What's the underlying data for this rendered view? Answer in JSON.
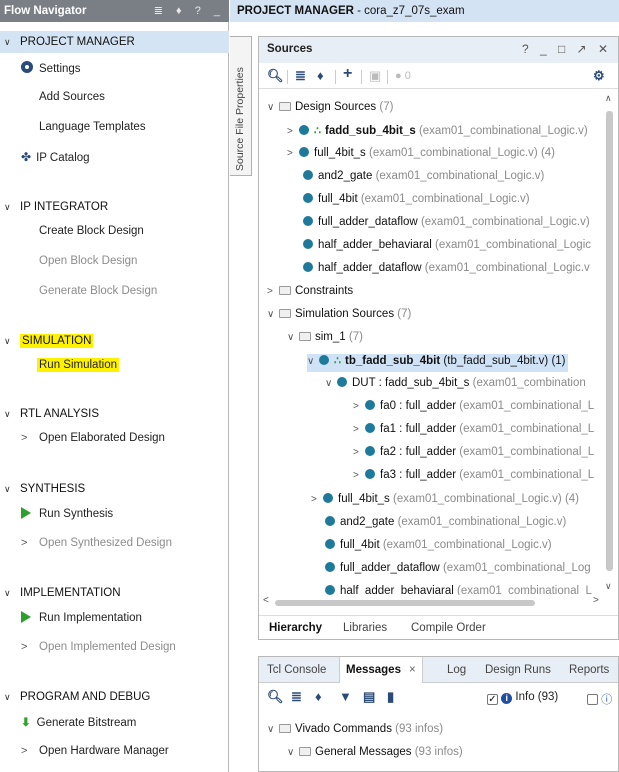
{
  "flow_navigator": {
    "title": "Flow Navigator",
    "tools": "≣ ♦ ? _",
    "project_manager": {
      "label": "PROJECT MANAGER",
      "items": [
        "Settings",
        "Add Sources",
        "Language Templates",
        "IP Catalog"
      ]
    },
    "ip_integrator": {
      "label": "IP INTEGRATOR",
      "items": [
        "Create Block Design",
        "Open Block Design",
        "Generate Block Design"
      ]
    },
    "simulation": {
      "label": "SIMULATION",
      "items": [
        "Run Simulation"
      ]
    },
    "rtl_analysis": {
      "label": "RTL ANALYSIS",
      "items": [
        "Open Elaborated Design"
      ]
    },
    "synthesis": {
      "label": "SYNTHESIS",
      "items": [
        "Run Synthesis",
        "Open Synthesized Design"
      ]
    },
    "implementation": {
      "label": "IMPLEMENTATION",
      "items": [
        "Run Implementation",
        "Open Implemented Design"
      ]
    },
    "program_debug": {
      "label": "PROGRAM AND DEBUG",
      "items": [
        "Generate Bitstream",
        "Open Hardware Manager"
      ]
    }
  },
  "header": {
    "prefix": "PROJECT MANAGER",
    "project": " - cora_z7_07s_exam"
  },
  "side_tab": "Source File Properties",
  "sources": {
    "title": "Sources",
    "window_tools": "? _ □ ↗ ✕",
    "toolbar_count": "0",
    "tree": [
      {
        "name": "Design Sources",
        "detail": " (7)"
      },
      {
        "name": "fadd_sub_4bit_s",
        "detail": " (exam01_combinational_Logic.v)"
      },
      {
        "name": "full_4bit_s",
        "detail": " (exam01_combinational_Logic.v) (4)"
      },
      {
        "name": "and2_gate",
        "detail": " (exam01_combinational_Logic.v)"
      },
      {
        "name": "full_4bit",
        "detail": " (exam01_combinational_Logic.v)"
      },
      {
        "name": "full_adder_dataflow",
        "detail": " (exam01_combinational_Logic.v)"
      },
      {
        "name": "half_adder_behaviaral",
        "detail": " (exam01_combinational_Logic"
      },
      {
        "name": "half_adder_dataflow",
        "detail": " (exam01_combinational_Logic.v"
      },
      {
        "name": "Constraints",
        "detail": ""
      },
      {
        "name": "Simulation Sources",
        "detail": " (7)"
      },
      {
        "name": "sim_1",
        "detail": " (7)"
      },
      {
        "name": "tb_fadd_sub_4bit",
        "detail": " (tb_fadd_sub_4bit.v) (1)"
      },
      {
        "name": "DUT : fadd_sub_4bit_s",
        "detail": " (exam01_combination"
      },
      {
        "name": "fa0 : full_adder",
        "detail": " (exam01_combinational_L"
      },
      {
        "name": "fa1 : full_adder",
        "detail": " (exam01_combinational_L"
      },
      {
        "name": "fa2 : full_adder",
        "detail": " (exam01_combinational_L"
      },
      {
        "name": "fa3 : full_adder",
        "detail": " (exam01_combinational_L"
      },
      {
        "name": "full_4bit_s",
        "detail": " (exam01_combinational_Logic.v) (4)"
      },
      {
        "name": "and2_gate",
        "detail": " (exam01_combinational_Logic.v)"
      },
      {
        "name": "full_4bit",
        "detail": " (exam01_combinational_Logic.v)"
      },
      {
        "name": "full_adder_dataflow",
        "detail": " (exam01_combinational_Log"
      },
      {
        "name": "half_adder_behaviaral",
        "detail": " (exam01_combinational_L"
      }
    ],
    "tabs": [
      "Hierarchy",
      "Libraries",
      "Compile Order"
    ]
  },
  "bottom": {
    "tabs": [
      "Tcl Console",
      "Messages",
      "Log",
      "Design Runs",
      "Reports"
    ],
    "close_glyph": "×",
    "info_filter": "Info (93)",
    "tree": [
      {
        "name": "Vivado Commands",
        "detail": " (93 infos)"
      },
      {
        "name": "General Messages",
        "detail": " (93 infos)"
      }
    ]
  },
  "colors": {
    "accent": "#2a4a78",
    "selection": "#cfe2f6",
    "highlight": "#fff200",
    "header_bg": "#d3e3f3"
  }
}
